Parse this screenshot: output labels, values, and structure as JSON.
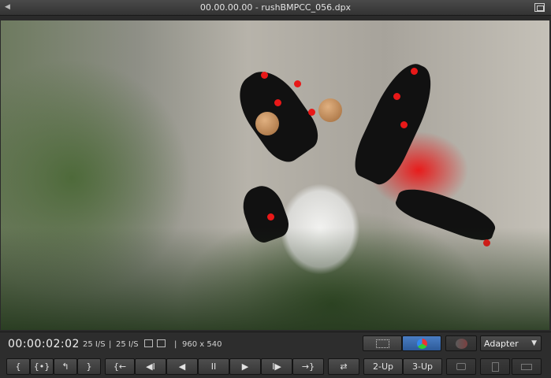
{
  "window": {
    "title": "00.00.00.00 - rushBMPCC_056.dpx"
  },
  "status": {
    "timecode": "00:00:02:02",
    "fps_a": "25 I/S",
    "separator1": "|",
    "fps_b": "25 I/S",
    "separator2": "|",
    "separator3": "|",
    "resolution": "960 x 540"
  },
  "view_modes": {
    "icons": [
      "grid-view-icon",
      "color-wheel-icon",
      "compare-icon"
    ],
    "active": "color-wheel-icon"
  },
  "output_select": {
    "value": "Adapter"
  },
  "transport": {
    "mark_in_label": "{",
    "mark_clip_label": "{•}",
    "go_to_in_label": "↰",
    "mark_out_label": "}",
    "prev_mark_label": "{←",
    "step_back_label": "◀I",
    "play_reverse_label": "◀",
    "pause_label": "II",
    "play_label": "▶",
    "step_forward_label": "I▶",
    "next_mark_label": "→}",
    "loop_label": "⇄",
    "two_up_label": "2-Up",
    "three_up_label": "3-Up"
  },
  "colors": {
    "accent": "#2d5a98",
    "background": "#2d2d2d"
  }
}
